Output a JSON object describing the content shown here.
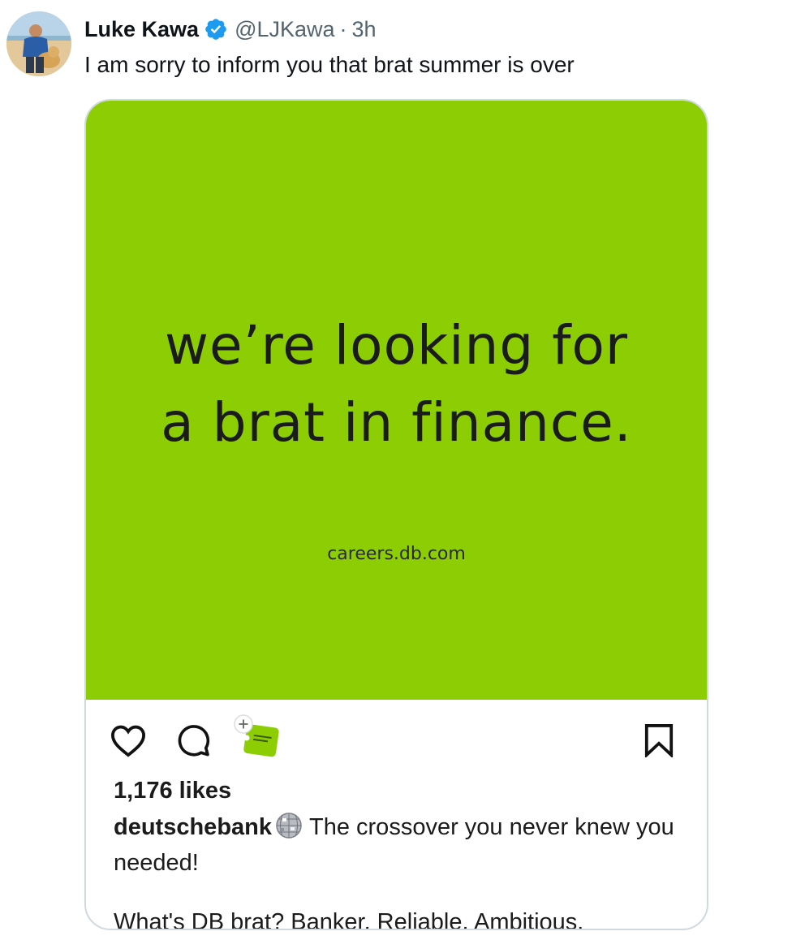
{
  "author": {
    "name": "Luke Kawa",
    "handle": "@LJKawa",
    "separator": "·",
    "time": "3h",
    "verified_icon": "verified-badge-icon",
    "verified_color": "#1d9bf0"
  },
  "tweet": {
    "text": "I am sorry to inform you that brat summer is over"
  },
  "media": {
    "background_color": "#8ccd04",
    "headline_line1": "we’re looking for",
    "headline_line2": "a brat in finance.",
    "url_text": "careers.db.com",
    "icons": [
      "heart-icon",
      "comment-icon",
      "sticker-icon",
      "bookmark-icon"
    ],
    "likes": "1,176 likes",
    "caption_user": "deutschebank",
    "caption_emoji": "disco-ball-icon",
    "caption_text": "The crossover you never knew you needed!",
    "caption_line2": "What's DB brat? Banker. Reliable. Ambitious."
  }
}
